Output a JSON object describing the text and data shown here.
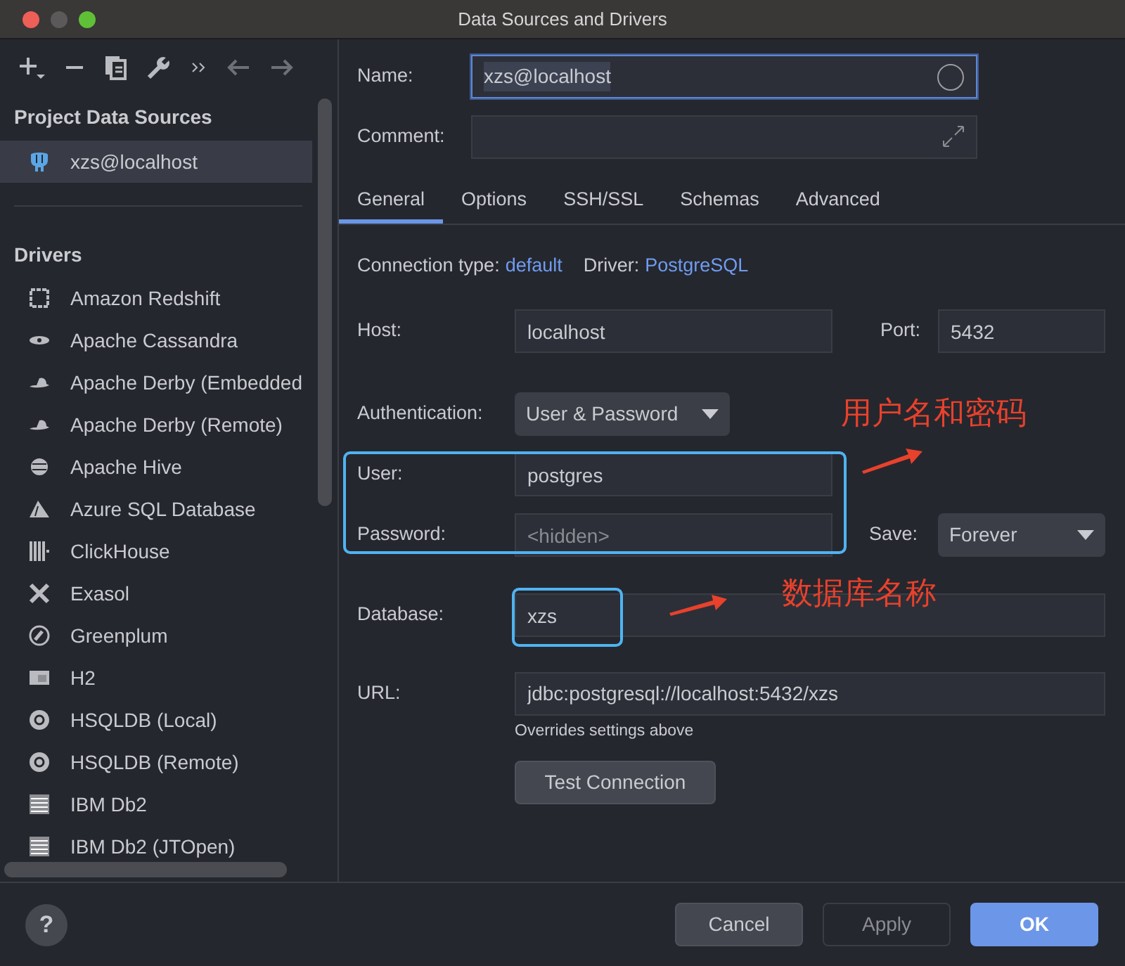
{
  "window": {
    "title": "Data Sources and Drivers"
  },
  "sidebar": {
    "project_heading": "Project Data Sources",
    "project_items": [
      {
        "label": "xzs@localhost",
        "selected": true
      }
    ],
    "drivers_heading": "Drivers",
    "drivers": [
      {
        "label": "Amazon Redshift",
        "selected": false
      },
      {
        "label": "Apache Cassandra",
        "selected": false
      },
      {
        "label": "Apache Derby (Embedded",
        "selected": false
      },
      {
        "label": "Apache Derby (Remote)",
        "selected": false
      },
      {
        "label": "Apache Hive",
        "selected": false
      },
      {
        "label": "Azure SQL Database",
        "selected": false
      },
      {
        "label": "ClickHouse",
        "selected": false
      },
      {
        "label": "Exasol",
        "selected": false
      },
      {
        "label": "Greenplum",
        "selected": false
      },
      {
        "label": "H2",
        "selected": false
      },
      {
        "label": "HSQLDB (Local)",
        "selected": false
      },
      {
        "label": "HSQLDB (Remote)",
        "selected": false
      },
      {
        "label": "IBM Db2",
        "selected": false
      },
      {
        "label": "IBM Db2 (JTOpen)",
        "selected": false
      }
    ]
  },
  "form": {
    "name": {
      "label": "Name:",
      "value": "xzs@localhost",
      "focused": true
    },
    "comment": {
      "label": "Comment:"
    },
    "tabs": [
      {
        "label": "General",
        "selected": true
      },
      {
        "label": "Options",
        "selected": false
      },
      {
        "label": "SSH/SSL",
        "selected": false
      },
      {
        "label": "Schemas",
        "selected": false
      },
      {
        "label": "Advanced",
        "selected": false
      }
    ],
    "connection_type_label": "Connection type:",
    "connection_type": "default",
    "driver_label": "Driver:",
    "driver": "PostgreSQL",
    "host": {
      "label": "Host:",
      "value": "localhost"
    },
    "port": {
      "label": "Port:",
      "value": "5432"
    },
    "authentication": {
      "label": "Authentication:",
      "value": "User & Password"
    },
    "user": {
      "label": "User:",
      "value": "postgres"
    },
    "password": {
      "label": "Password:",
      "placeholder": "<hidden>"
    },
    "save": {
      "label": "Save:",
      "value": "Forever"
    },
    "database": {
      "label": "Database:",
      "value": "xzs"
    },
    "url": {
      "label": "URL:",
      "value": "jdbc:postgresql://localhost:5432/xzs",
      "hint": "Overrides settings above"
    },
    "test_button": "Test Connection"
  },
  "annotations": [
    {
      "text": "用户名和密码"
    },
    {
      "text": "数据库名称"
    }
  ],
  "help_button": "?",
  "buttons": [
    {
      "label": "Cancel",
      "kind": "secondary",
      "disabled": false
    },
    {
      "label": "Apply",
      "kind": "secondary",
      "disabled": true
    },
    {
      "label": "OK",
      "kind": "primary",
      "disabled": false
    }
  ]
}
